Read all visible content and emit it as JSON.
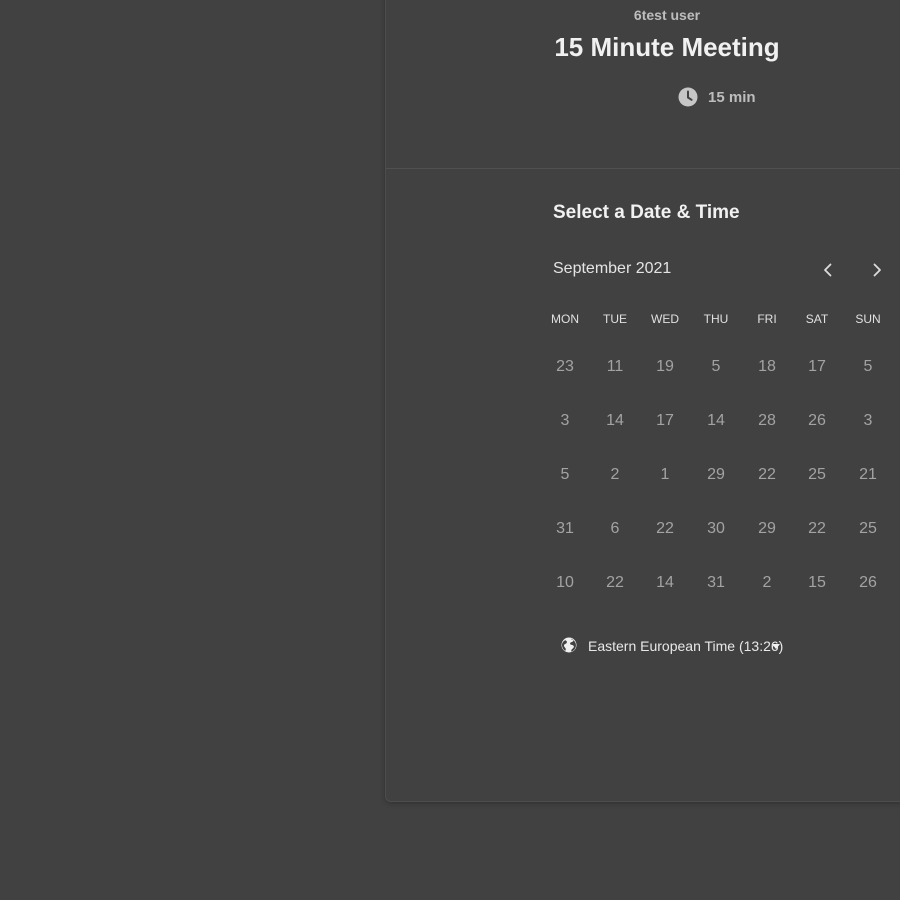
{
  "header": {
    "owner_name": "6test user",
    "event_title": "15 Minute Meeting",
    "duration": "15 min"
  },
  "calendar": {
    "section_title": "Select a Date & Time",
    "month_label": "September 2021",
    "weekdays": [
      "MON",
      "TUE",
      "WED",
      "THU",
      "FRI",
      "SAT",
      "SUN"
    ],
    "weeks": [
      [
        "23",
        "11",
        "19",
        "5",
        "18",
        "17",
        "5"
      ],
      [
        "3",
        "14",
        "17",
        "14",
        "28",
        "26",
        "3"
      ],
      [
        "5",
        "2",
        "1",
        "29",
        "22",
        "25",
        "21"
      ],
      [
        "31",
        "6",
        "22",
        "30",
        "29",
        "22",
        "25"
      ],
      [
        "10",
        "22",
        "14",
        "31",
        "2",
        "15",
        "26"
      ]
    ]
  },
  "timezone": {
    "label": "Eastern European Time (13:26)"
  },
  "icons": {
    "clock": "clock-icon",
    "prev": "chevron-left-icon",
    "next": "chevron-right-icon",
    "globe": "globe-icon",
    "caret": "caret-down-icon"
  },
  "colors": {
    "background": "#414141",
    "title_text": "#f1f1f1",
    "muted_text": "#bdbdbd",
    "day_text": "#a3a3a3"
  }
}
